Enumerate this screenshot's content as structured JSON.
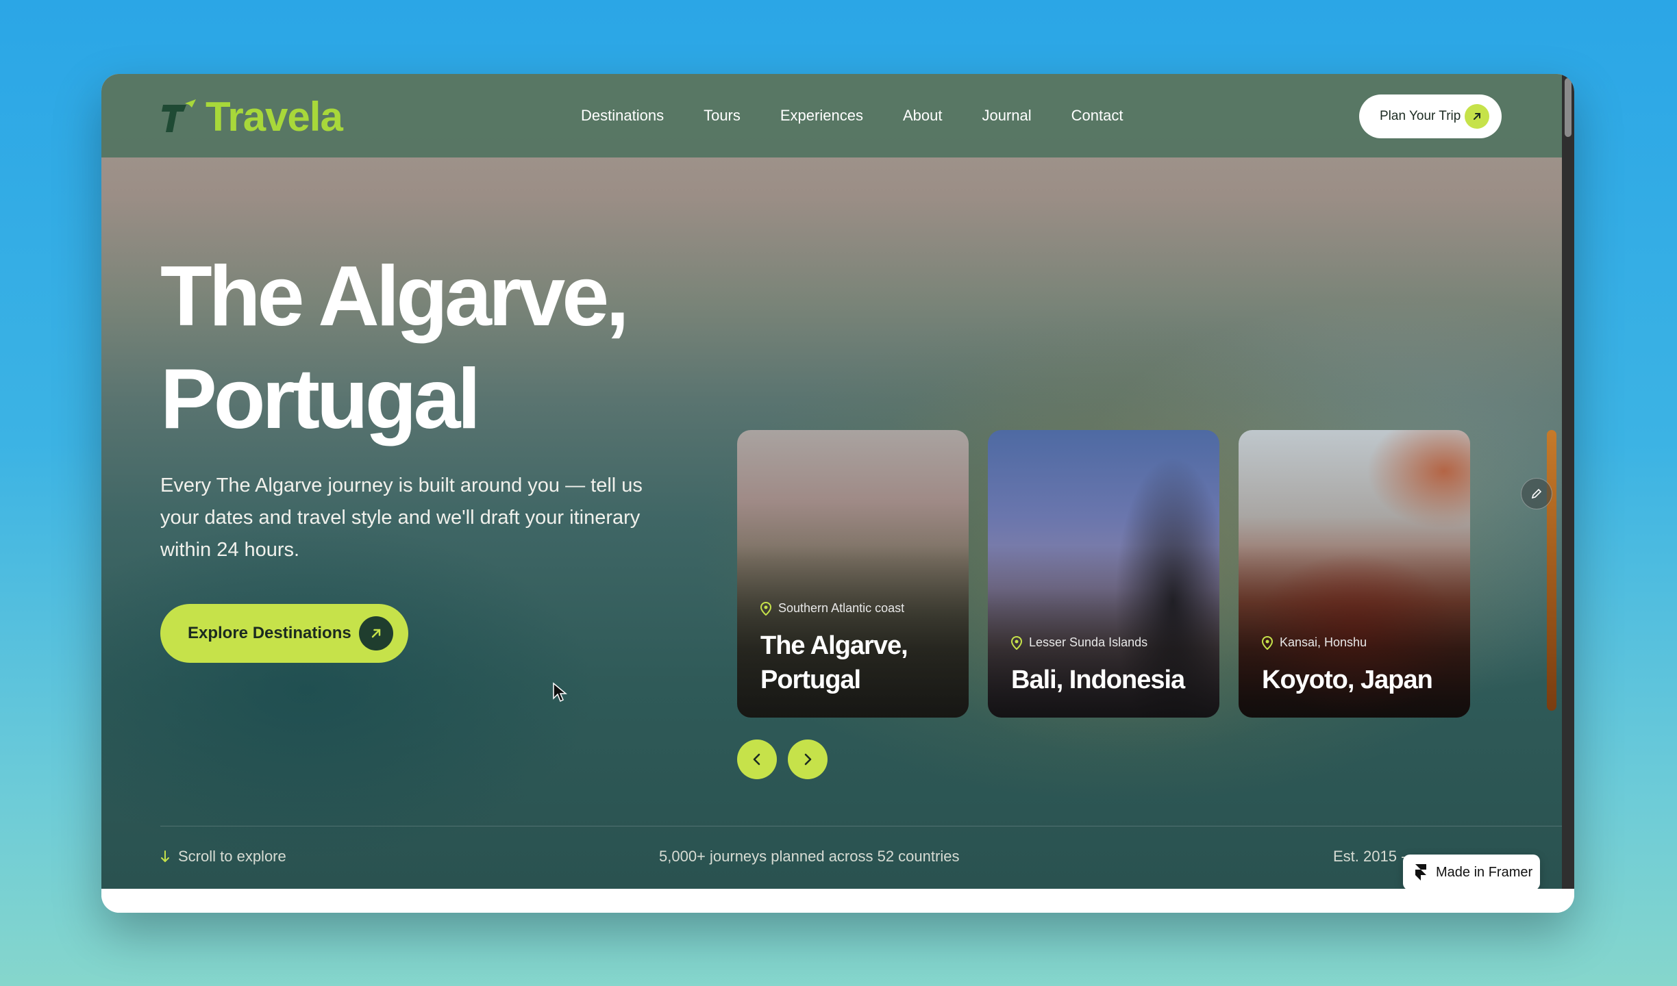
{
  "brand": {
    "name": "Travela"
  },
  "nav": {
    "links": [
      "Destinations",
      "Tours",
      "Experiences",
      "About",
      "Journal",
      "Contact"
    ]
  },
  "header": {
    "cta_label": "Plan Your Trip"
  },
  "hero": {
    "title_line1": "The Algarve,",
    "title_line2": "Portugal",
    "description": "Every The Algarve journey is built around you — tell us your dates and travel style and we'll draft your itinerary within 24 hours.",
    "cta_label": "Explore Destinations"
  },
  "cards": [
    {
      "region": "Southern Atlantic coast",
      "name": "The Algarve, Portugal"
    },
    {
      "region": "Lesser Sunda Islands",
      "name": "Bali, Indonesia"
    },
    {
      "region": "Kansai, Honshu",
      "name": "Koyoto, Japan"
    }
  ],
  "footer": {
    "scroll_hint": "Scroll to explore",
    "stat": "5,000+ journeys planned across 52 countries",
    "est": "Est. 2015 -",
    "badge": "Made in Framer"
  },
  "colors": {
    "accent": "#c6e24a",
    "brand_green": "#a8d83a",
    "nav_bg": "#50735f"
  },
  "icons": [
    "arrow-up-right-icon",
    "location-pin-icon",
    "chevron-left-icon",
    "chevron-right-icon",
    "arrow-down-icon",
    "pencil-icon",
    "framer-logo-icon"
  ]
}
